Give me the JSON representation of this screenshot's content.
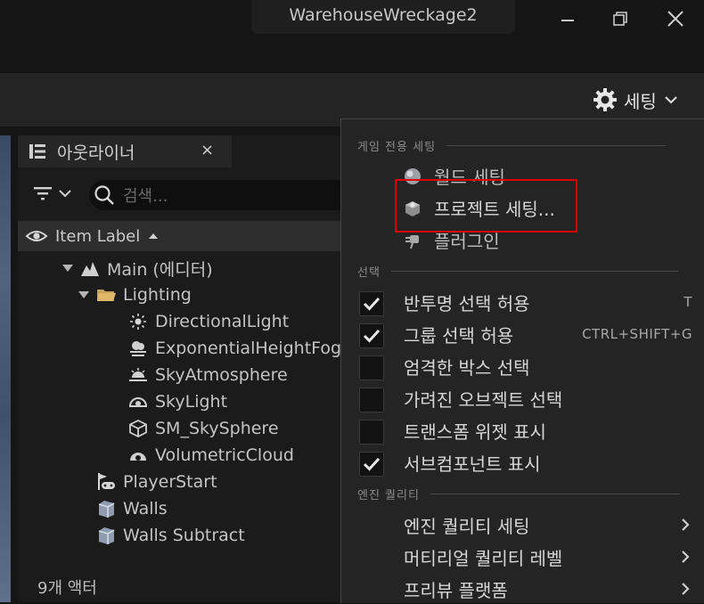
{
  "window": {
    "title": "WarehouseWreckage2"
  },
  "toolbar": {
    "settings_label": "세팅"
  },
  "outliner": {
    "tab_label": "아웃라이너",
    "tab_close": "×",
    "search_placeholder": "검색...",
    "column_header": "Item Label",
    "tree": [
      {
        "label": "Main (에디터)",
        "icon": "level-icon",
        "indent": 0,
        "expanded": true
      },
      {
        "label": "Lighting",
        "icon": "folder-icon",
        "indent": 1,
        "expanded": true
      },
      {
        "label": "DirectionalLight",
        "icon": "directional-light-icon",
        "indent": 2
      },
      {
        "label": "ExponentialHeightFog",
        "icon": "fog-icon",
        "indent": 2
      },
      {
        "label": "SkyAtmosphere",
        "icon": "sky-atmosphere-icon",
        "indent": 2
      },
      {
        "label": "SkyLight",
        "icon": "skylight-icon",
        "indent": 2
      },
      {
        "label": "SM_SkySphere",
        "icon": "static-mesh-icon",
        "indent": 2
      },
      {
        "label": "VolumetricCloud",
        "icon": "cloud-icon",
        "indent": 2
      },
      {
        "label": "PlayerStart",
        "icon": "player-start-icon",
        "indent": 1
      },
      {
        "label": "Walls",
        "icon": "brush-icon",
        "indent": 1
      },
      {
        "label": "Walls Subtract",
        "icon": "brush-icon",
        "indent": 1
      }
    ],
    "footer": "9개 액터"
  },
  "menu": {
    "sections": [
      {
        "title": "게임 전용 세팅",
        "items": [
          {
            "label": "월드 세팅",
            "icon": "world-settings-icon"
          },
          {
            "label": "프로젝트 세팅...",
            "icon": "project-settings-icon"
          },
          {
            "label": "플러그인",
            "icon": "plugin-icon"
          }
        ]
      },
      {
        "title": "선택",
        "items": [
          {
            "label": "반투명 선택 허용",
            "checked": true,
            "shortcut": "T"
          },
          {
            "label": "그룹 선택 허용",
            "checked": true,
            "shortcut": "CTRL+SHIFT+G"
          },
          {
            "label": "엄격한 박스 선택",
            "checked": false,
            "shortcut": ""
          },
          {
            "label": "가려진 오브젝트 선택",
            "checked": false,
            "shortcut": ""
          },
          {
            "label": "트랜스폼 위젯 표시",
            "checked": false,
            "shortcut": ""
          },
          {
            "label": "서브컴포넌트 표시",
            "checked": true,
            "shortcut": ""
          }
        ]
      },
      {
        "title": "엔진 퀄리티",
        "items": [
          {
            "label": "엔진 퀄리티 세팅",
            "submenu": true
          },
          {
            "label": "머티리얼 퀄리티 레벨",
            "submenu": true
          },
          {
            "label": "프리뷰 플랫폼",
            "submenu": true
          }
        ]
      }
    ]
  },
  "colors": {
    "highlight": "#e10000",
    "menu_bg": "#242424",
    "panel_bg": "#1b1b1b"
  }
}
